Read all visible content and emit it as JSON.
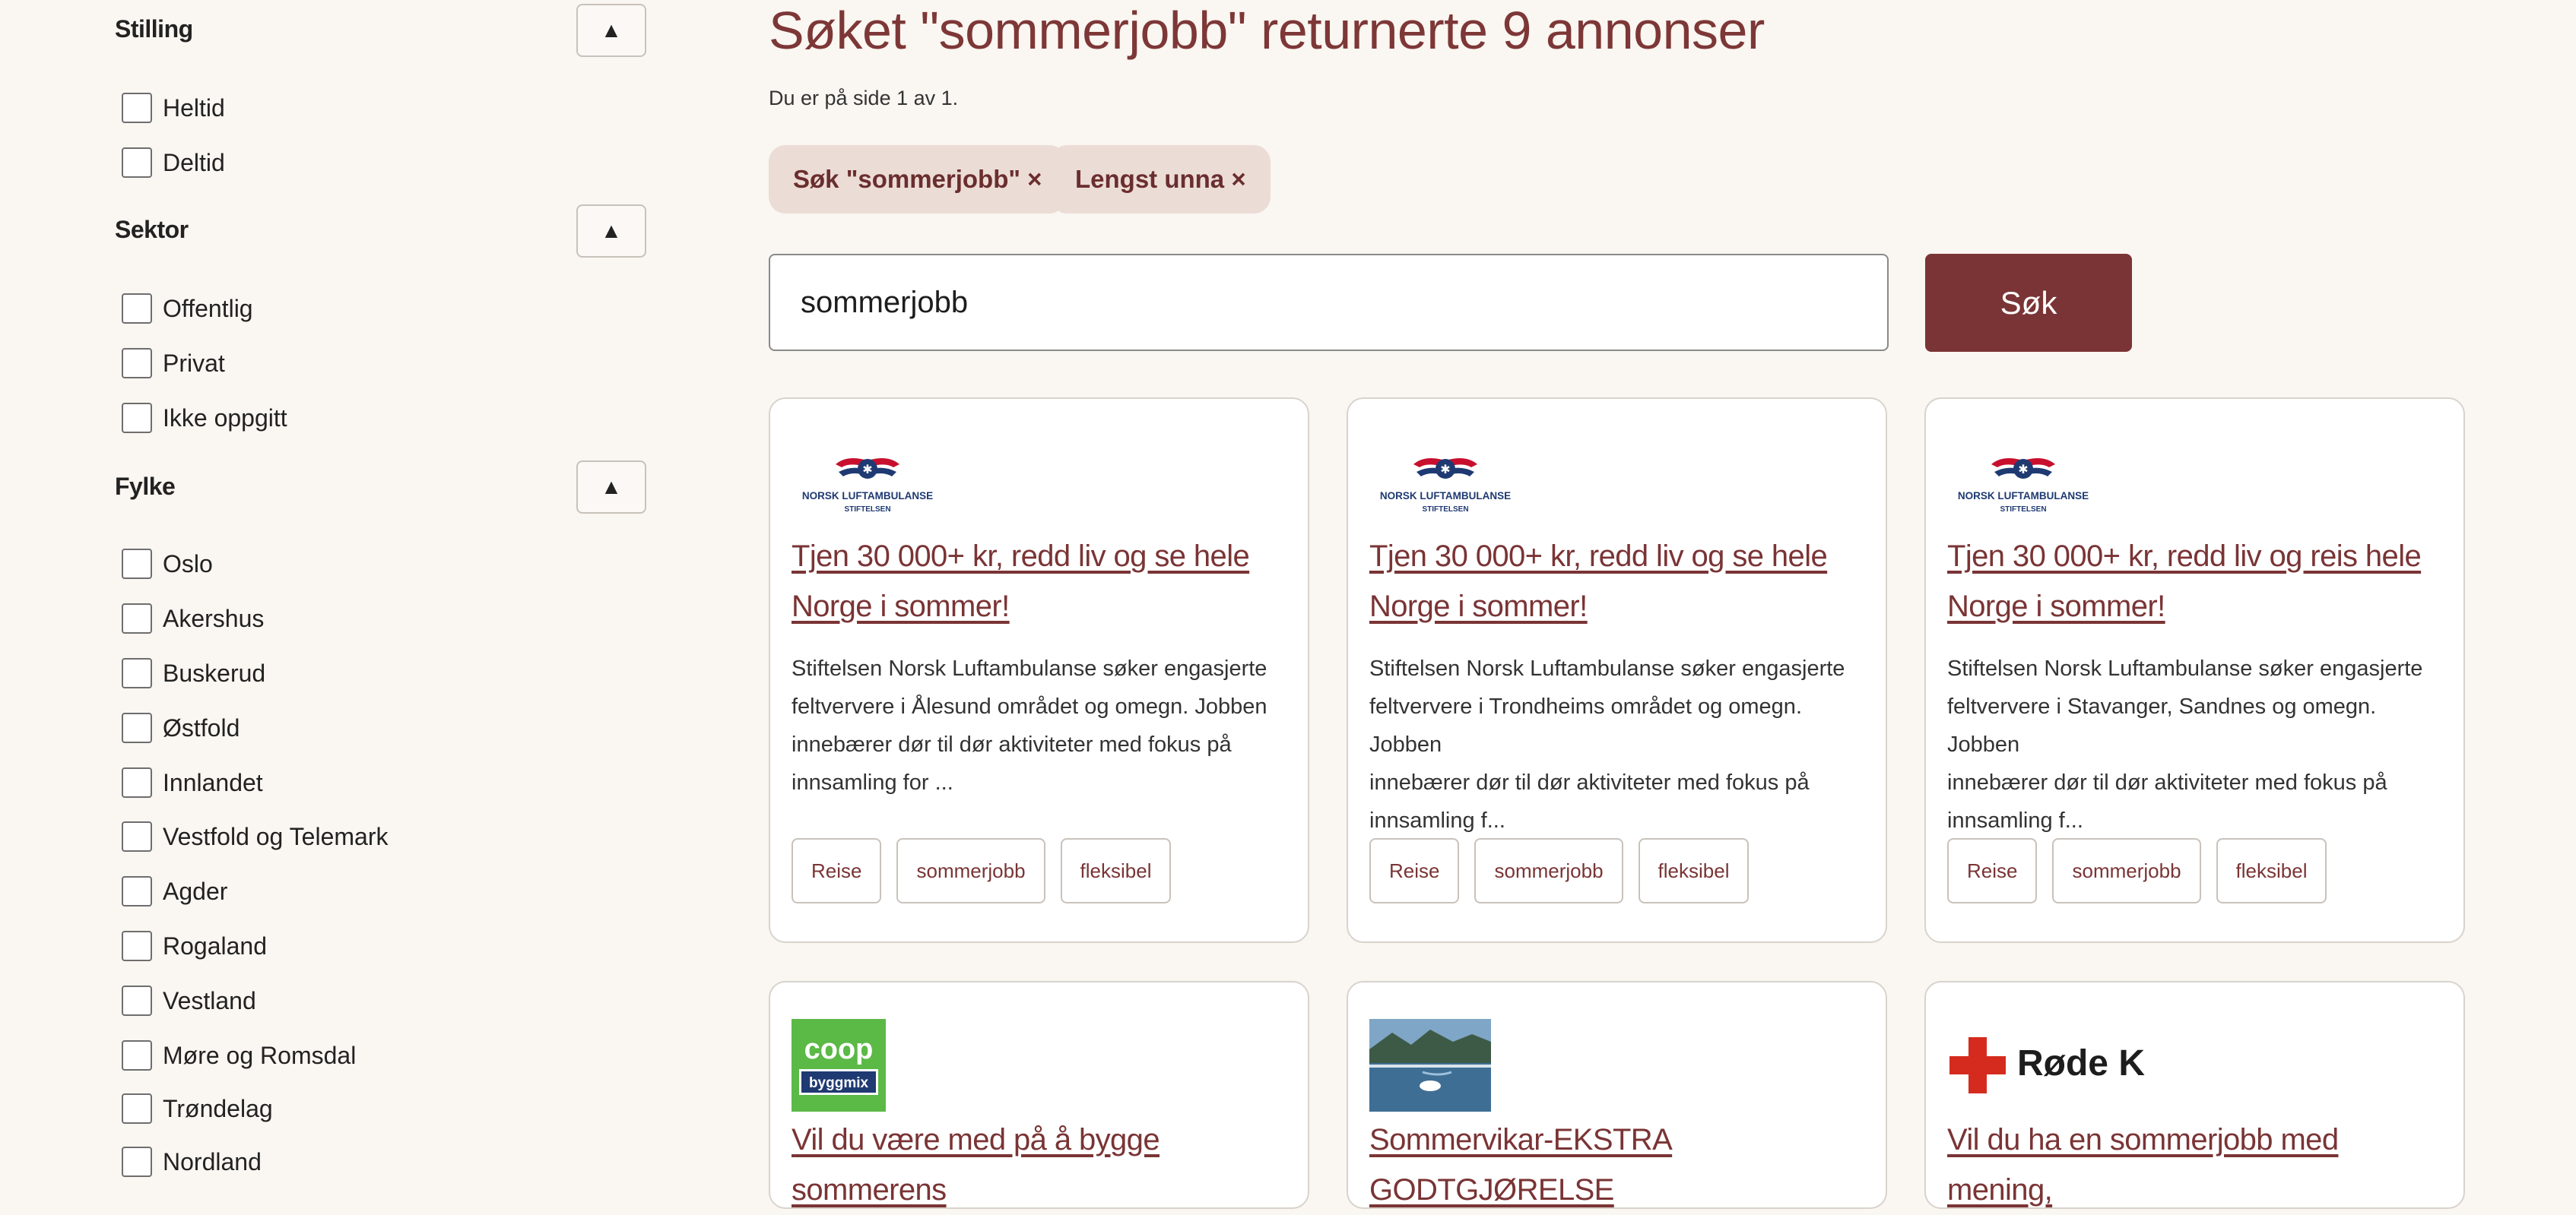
{
  "sidebar": {
    "sections": [
      {
        "title": "Stilling",
        "toggle": "▲",
        "options": [
          "Heltid",
          "Deltid"
        ]
      },
      {
        "title": "Sektor",
        "toggle": "▲",
        "options": [
          "Offentlig",
          "Privat",
          "Ikke oppgitt"
        ]
      },
      {
        "title": "Fylke",
        "toggle": "▲",
        "options": [
          "Oslo",
          "Akershus",
          "Buskerud",
          "Østfold",
          "Innlandet",
          "Vestfold og Telemark",
          "Agder",
          "Rogaland",
          "Vestland",
          "Møre og Romsdal",
          "Trøndelag",
          "Nordland"
        ]
      }
    ]
  },
  "main": {
    "title": "Søket \"sommerjobb\" returnerte 9 annonser",
    "page_info": "Du er på side 1 av 1.",
    "filters": [
      "Søk \"sommerjobb\" ×",
      "Lengst unna ×"
    ],
    "search": {
      "value": "sommerjobb",
      "button": "Søk"
    }
  },
  "logos": {
    "nla": "NORSK LUFTAMBULANSE",
    "nla_sub": "STIFTELSEN",
    "coop_top": "coop",
    "coop_bottom": "byggmix",
    "redcross": "Røde Kors"
  },
  "cards": [
    {
      "title_line1": "Tjen 30 000+ kr, redd liv og se hele",
      "title_line2": "Norge i sommer!",
      "desc": [
        "Stiftelsen Norsk Luftambulanse søker engasjerte",
        "feltververe i Ålesund området og omegn. Jobben",
        "innebærer dør til dør aktiviteter med fokus på",
        "innsamling for ..."
      ],
      "tags": [
        "Reise",
        "sommerjobb",
        "fleksibel"
      ]
    },
    {
      "title_line1": "Tjen 30 000+ kr, redd liv og se hele",
      "title_line2": "Norge i sommer!",
      "desc": [
        "Stiftelsen Norsk Luftambulanse søker engasjerte",
        "feltververe i Trondheims området og omegn. Jobben",
        "innebærer dør til dør aktiviteter med fokus på",
        "innsamling f..."
      ],
      "tags": [
        "Reise",
        "sommerjobb",
        "fleksibel"
      ]
    },
    {
      "title_line1": "Tjen 30 000+ kr, redd liv og reis hele",
      "title_line2": "Norge i sommer!",
      "desc": [
        "Stiftelsen Norsk Luftambulanse søker engasjerte",
        "feltververe i Stavanger, Sandnes og omegn. Jobben",
        "innebærer dør til dør aktiviteter med fokus på",
        "innsamling f..."
      ],
      "tags": [
        "Reise",
        "sommerjobb",
        "fleksibel"
      ]
    },
    {
      "title_line1": "Vil du være med på å bygge sommerens"
    },
    {
      "title_line1": "Sommervikar-EKSTRA GODTGJØRELSE"
    },
    {
      "title_line1": "Vil du ha en sommerjobb med mening,"
    }
  ],
  "colors": {
    "accent": "#7a3435",
    "chip_bg": "#ecdcd6",
    "background": "#faf6f1"
  }
}
